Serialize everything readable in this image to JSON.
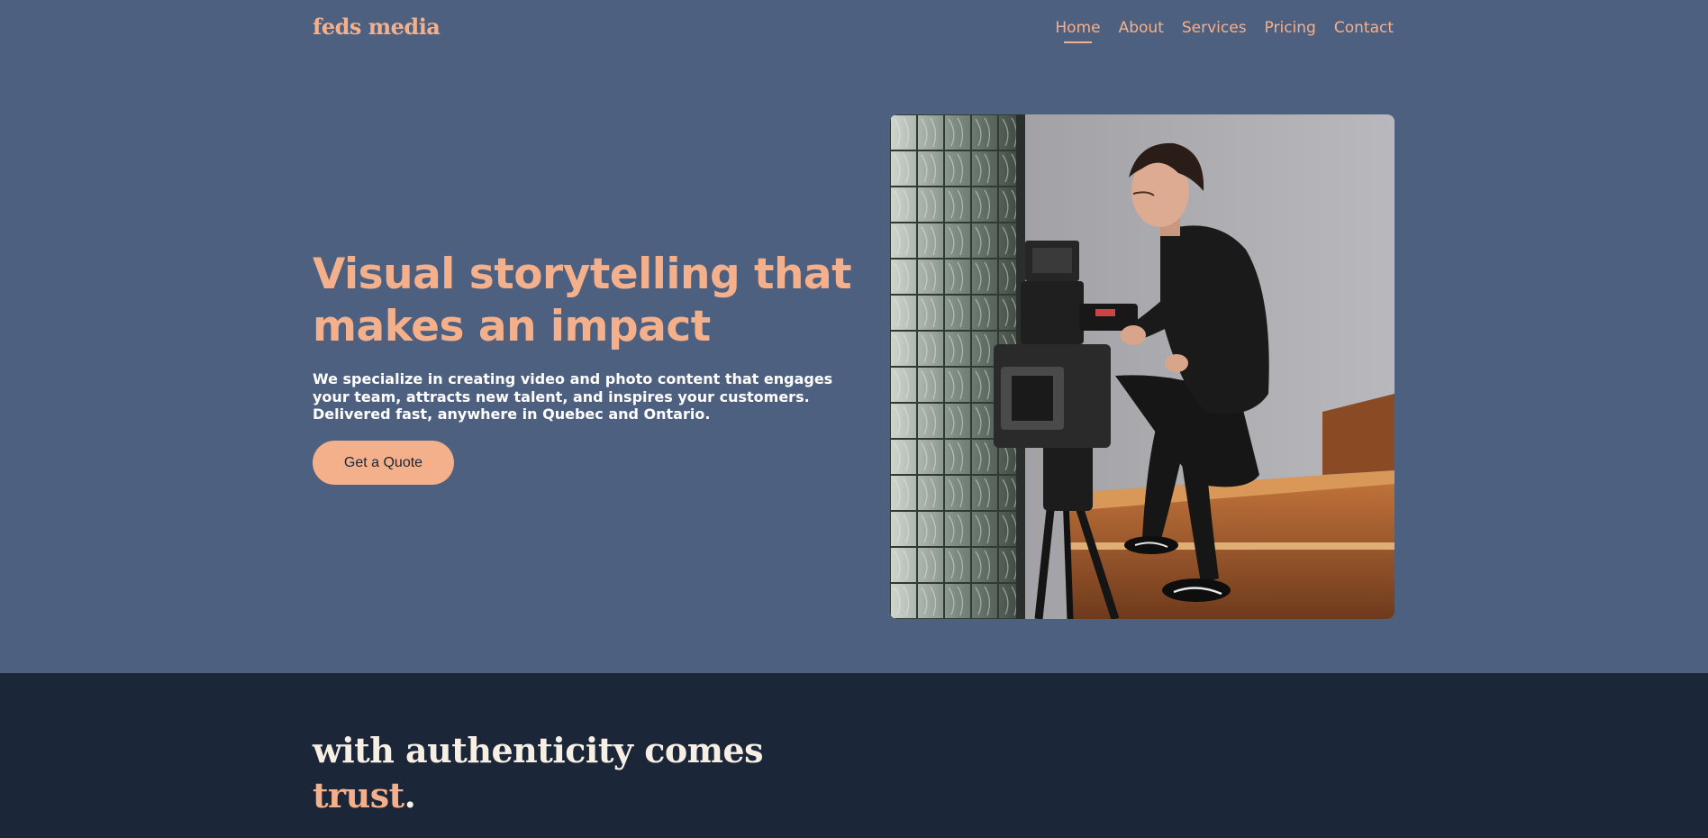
{
  "header": {
    "logo": "feds media",
    "nav": [
      {
        "label": "Home",
        "active": true
      },
      {
        "label": "About",
        "active": false
      },
      {
        "label": "Services",
        "active": false
      },
      {
        "label": "Pricing",
        "active": false
      },
      {
        "label": "Contact",
        "active": false
      }
    ]
  },
  "hero": {
    "headline": "Visual storytelling that makes an impact",
    "subtext": "We specialize in creating video and photo content that engages your team, attracts new talent, and inspires your customers. Delivered fast, anywhere in Quebec and Ontario.",
    "cta_label": "Get a Quote",
    "image_subject": "videographer operating a cinema camera on tripod"
  },
  "trust": {
    "line1": "with authenticity comes",
    "line2_accent": "trust",
    "line2_end": "."
  },
  "colors": {
    "hero_bg": "#4e6080",
    "accent": "#f4b08a",
    "dark_bg": "#1b2638",
    "cream": "#f7efe4"
  }
}
